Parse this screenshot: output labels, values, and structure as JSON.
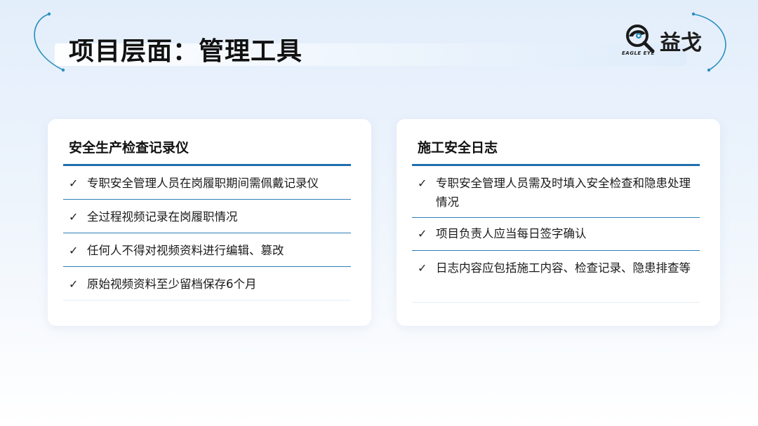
{
  "header": {
    "title": "项目层面：管理工具"
  },
  "logo": {
    "name": "益戈",
    "sub": "EAGLE EYE"
  },
  "cards": [
    {
      "title": "安全生产检查记录仪",
      "items": [
        "专职安全管理人员在岗履职期间需佩戴记录仪",
        "全过程视频记录在岗履职情况",
        "任何人不得对视频资料进行编辑、篡改",
        "原始视频资料至少留档保存6个月"
      ]
    },
    {
      "title": "施工安全日志",
      "items": [
        "专职安全管理人员需及时填入安全检查和隐患处理情况",
        "项目负责人应当每日签字确认",
        "日志内容应包括施工内容、检查记录、隐患排查等"
      ]
    }
  ],
  "check_symbol": "✓",
  "colors": {
    "accent": "#1f6fae",
    "divider": "#2c7fb8",
    "arc": "#2a8fbd"
  },
  "icons": [
    "check-icon",
    "eagle-eye-logo-icon",
    "decorative-arc"
  ]
}
